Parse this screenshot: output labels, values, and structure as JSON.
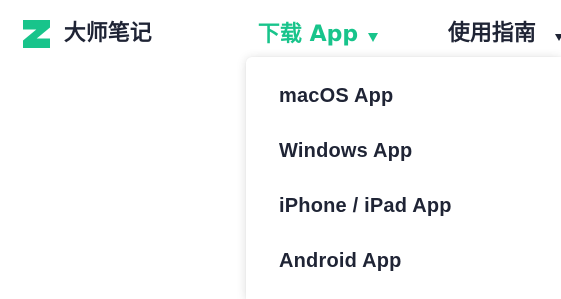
{
  "brand": {
    "name": "大师笔记",
    "logo_icon": "letter-z-logo-icon",
    "logo_color": "#18c48b"
  },
  "nav": {
    "download_label": "下载 App",
    "download_icon": "caret-down-icon",
    "download_color": "#18c48b",
    "guide_label": "使用指南"
  },
  "dropdown": {
    "items": [
      {
        "label": "macOS App"
      },
      {
        "label": "Windows App"
      },
      {
        "label": "iPhone / iPad App"
      },
      {
        "label": "Android App"
      }
    ]
  },
  "colors": {
    "accent": "#18c48b",
    "text": "#1f2435",
    "background": "#ffffff"
  }
}
